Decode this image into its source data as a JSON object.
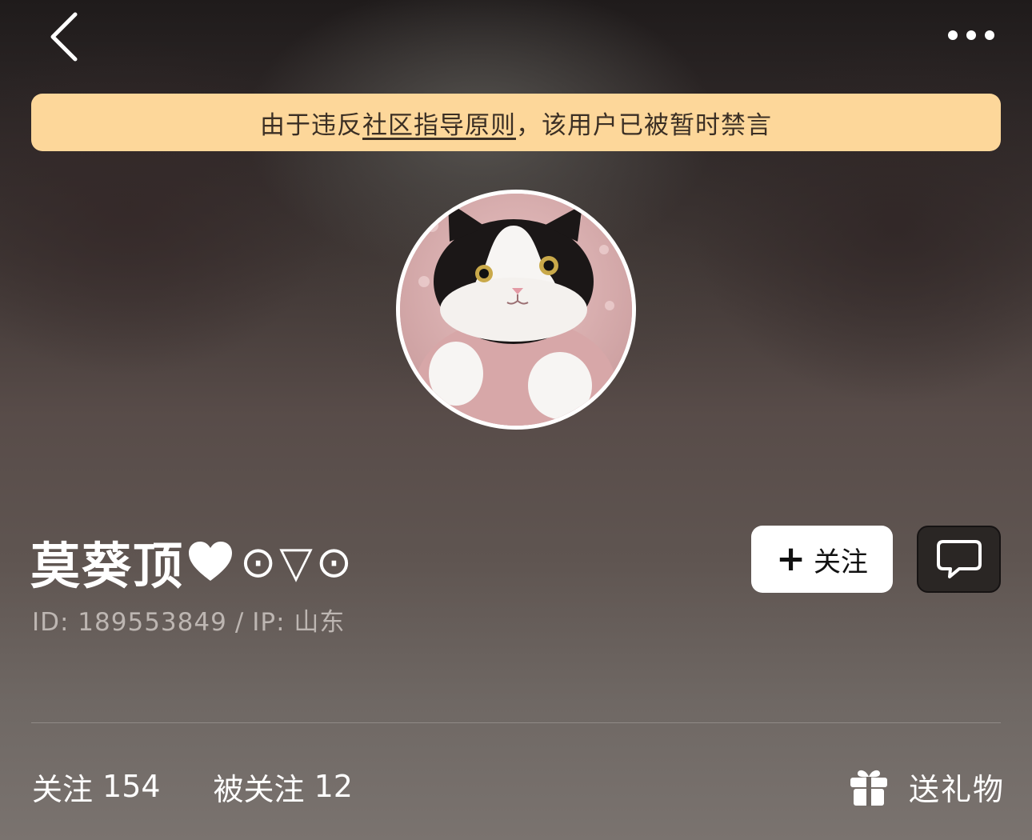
{
  "topbar": {
    "back_icon": "chevron-left-icon",
    "more_icon": "more-horizontal-icon"
  },
  "notice": {
    "prefix": "由于违反",
    "link": "社区指导原则",
    "suffix": "，该用户已被暂时禁言",
    "bg_color": "#fdd79a"
  },
  "profile": {
    "avatar_alt": "cat-avatar",
    "name": "莫葵顶",
    "name_heart_icon": "heart-icon",
    "name_face": "⊙▽⊙",
    "id_text": "ID: 189553849",
    "separator": "/",
    "ip_text": "IP: 山东"
  },
  "actions": {
    "follow_plus": "+",
    "follow_label": "关注",
    "chat_icon": "chat-bubble-icon"
  },
  "stats": {
    "following_label": "关注",
    "following_count": "154",
    "followers_label": "被关注",
    "followers_count": "12",
    "gift_icon": "gift-icon",
    "gift_label": "送礼物"
  }
}
